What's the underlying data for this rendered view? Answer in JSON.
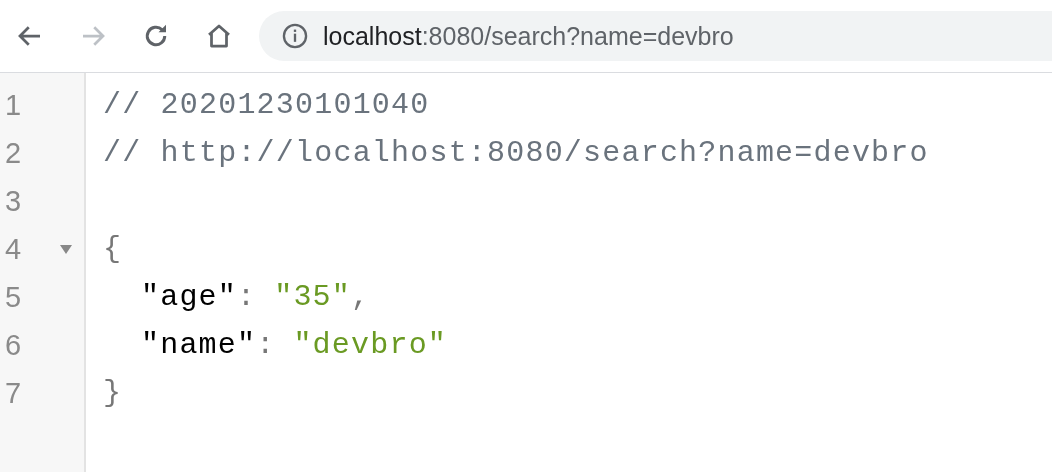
{
  "toolbar": {
    "buttons": [
      {
        "kind": "back",
        "disabled": false
      },
      {
        "kind": "forward",
        "disabled": true
      },
      {
        "kind": "reload",
        "disabled": false
      },
      {
        "kind": "home",
        "disabled": false
      }
    ],
    "address": {
      "host": "localhost",
      "rest": ":8080/search?name=devbro"
    }
  },
  "code": {
    "lines": [
      {
        "number": "1",
        "tokens": [
          {
            "kind": "comment",
            "text": "// 20201230101040"
          }
        ]
      },
      {
        "number": "2",
        "tokens": [
          {
            "kind": "comment",
            "text": "// http://localhost:8080/search?name=devbro"
          }
        ]
      },
      {
        "number": "3"
      },
      {
        "number": "4",
        "expanded": true,
        "tokens": [
          {
            "kind": "punct",
            "text": "{"
          }
        ],
        "children": [
          {
            "number": "5",
            "tokens": [
              {
                "kind": "key",
                "text": "\"age\""
              },
              {
                "kind": "punct",
                "text": ":"
              },
              {
                "kind": "string",
                "text": "\"35\""
              },
              {
                "kind": "punct",
                "text": ","
              }
            ]
          },
          {
            "number": "6",
            "tokens": [
              {
                "kind": "key",
                "text": "\"name\""
              },
              {
                "kind": "punct",
                "text": ":"
              },
              {
                "kind": "string",
                "text": "\"devbro\""
              }
            ]
          }
        ]
      },
      {
        "number": "7",
        "tokens": [
          {
            "kind": "punct",
            "text": "}"
          }
        ]
      }
    ]
  }
}
